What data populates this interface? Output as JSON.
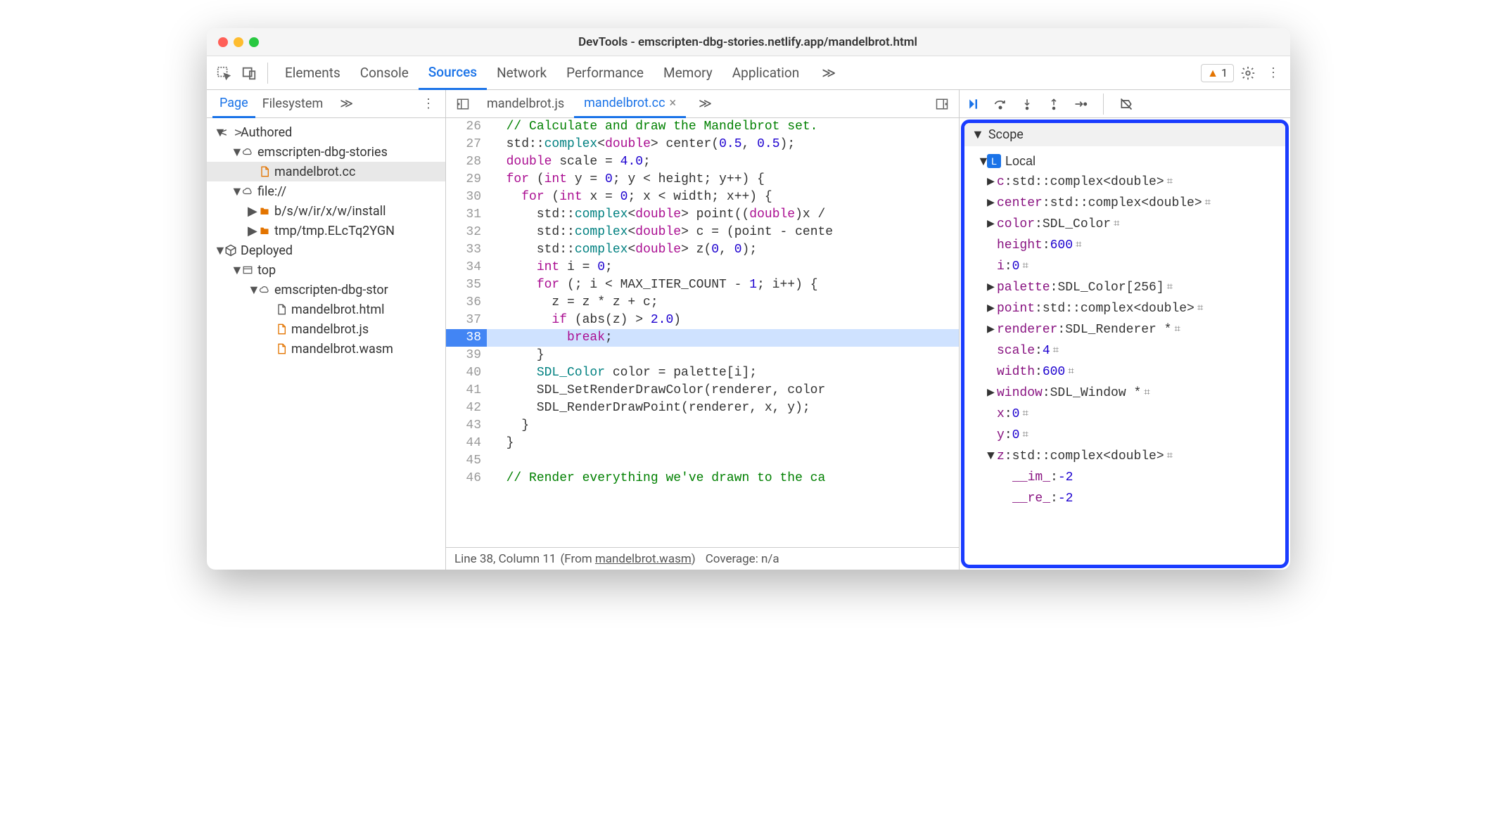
{
  "window": {
    "title": "DevTools - emscripten-dbg-stories.netlify.app/mandelbrot.html"
  },
  "tabs": {
    "items": [
      "Elements",
      "Console",
      "Sources",
      "Network",
      "Performance",
      "Memory",
      "Application"
    ],
    "active": "Sources",
    "warning_count": "1"
  },
  "sidebar": {
    "tabs": [
      "Page",
      "Filesystem"
    ],
    "active": "Page",
    "tree": [
      {
        "indent": 0,
        "twisty": "▼",
        "icon": "brackets",
        "label": "Authored"
      },
      {
        "indent": 1,
        "twisty": "▼",
        "icon": "cloud",
        "label": "emscripten-dbg-stories"
      },
      {
        "indent": 2,
        "twisty": "",
        "icon": "file-orange",
        "label": "mandelbrot.cc",
        "selected": true
      },
      {
        "indent": 1,
        "twisty": "▼",
        "icon": "cloud",
        "label": "file://"
      },
      {
        "indent": 2,
        "twisty": "▶",
        "icon": "folder-orange",
        "label": "b/s/w/ir/x/w/install"
      },
      {
        "indent": 2,
        "twisty": "▶",
        "icon": "folder-orange",
        "label": "tmp/tmp.ELcTq2YGN"
      },
      {
        "indent": 0,
        "twisty": "▼",
        "icon": "box",
        "label": "Deployed"
      },
      {
        "indent": 1,
        "twisty": "▼",
        "icon": "window",
        "label": "top"
      },
      {
        "indent": 2,
        "twisty": "▼",
        "icon": "cloud",
        "label": "emscripten-dbg-stor"
      },
      {
        "indent": 3,
        "twisty": "",
        "icon": "file",
        "label": "mandelbrot.html"
      },
      {
        "indent": 3,
        "twisty": "",
        "icon": "file-orange",
        "label": "mandelbrot.js"
      },
      {
        "indent": 3,
        "twisty": "",
        "icon": "file-orange",
        "label": "mandelbrot.wasm"
      }
    ]
  },
  "editor": {
    "tabs": [
      {
        "label": "mandelbrot.js",
        "active": false,
        "closable": false
      },
      {
        "label": "mandelbrot.cc",
        "active": true,
        "closable": true
      }
    ],
    "status": {
      "line": "Line 38, Column 11",
      "from": "mandelbrot.wasm",
      "coverage": "Coverage: n/a"
    },
    "lines": [
      {
        "n": 26,
        "html": "  <span class='cm'>// Calculate and draw the Mandelbrot set.</span>"
      },
      {
        "n": 27,
        "html": "  std::<span class='type'>complex</span>&lt;<span class='kw'>double</span>&gt; center(<span class='num'>0.5</span>, <span class='num'>0.5</span>);"
      },
      {
        "n": 28,
        "html": "  <span class='kw'>double</span> scale = <span class='num'>4.0</span>;"
      },
      {
        "n": 29,
        "html": "  <span class='kw'>for</span> (<span class='kw'>int</span> y = <span class='num'>0</span>; y &lt; height; y++) {"
      },
      {
        "n": 30,
        "html": "    <span class='kw'>for</span> (<span class='kw'>int</span> x = <span class='num'>0</span>; x &lt; width; x++) {"
      },
      {
        "n": 31,
        "html": "      std::<span class='type'>complex</span>&lt;<span class='kw'>double</span>&gt; point((<span class='kw'>double</span>)x /"
      },
      {
        "n": 32,
        "html": "      std::<span class='type'>complex</span>&lt;<span class='kw'>double</span>&gt; c = (point - cente"
      },
      {
        "n": 33,
        "html": "      std::<span class='type'>complex</span>&lt;<span class='kw'>double</span>&gt; z(<span class='num'>0</span>, <span class='num'>0</span>);"
      },
      {
        "n": 34,
        "html": "      <span class='kw'>int</span> i = <span class='num'>0</span>;"
      },
      {
        "n": 35,
        "html": "      <span class='kw'>for</span> (; i &lt; MAX_ITER_COUNT - <span class='num'>1</span>; i++) {"
      },
      {
        "n": 36,
        "html": "        z = z * z + c;"
      },
      {
        "n": 37,
        "html": "        <span class='kw'>if</span> (abs(z) &gt; <span class='num'>2.0</span>)"
      },
      {
        "n": 38,
        "html": "          <span class='kw'>break</span>;",
        "exec": true
      },
      {
        "n": 39,
        "html": "      }"
      },
      {
        "n": 40,
        "html": "      <span class='type'>SDL_Color</span> color = palette[i];"
      },
      {
        "n": 41,
        "html": "      SDL_SetRenderDrawColor(renderer, color"
      },
      {
        "n": 42,
        "html": "      SDL_RenderDrawPoint(renderer, x, y);"
      },
      {
        "n": 43,
        "html": "    }"
      },
      {
        "n": 44,
        "html": "  }"
      },
      {
        "n": 45,
        "html": ""
      },
      {
        "n": 46,
        "html": "  <span class='cm'>// Render everything we've drawn to the ca</span>"
      }
    ]
  },
  "scope": {
    "title": "Scope",
    "section": "Local",
    "vars": [
      {
        "twisty": "▶",
        "name": "c",
        "type": "std::complex<double>",
        "mem": true
      },
      {
        "twisty": "▶",
        "name": "center",
        "type": "std::complex<double>",
        "mem": true
      },
      {
        "twisty": "▶",
        "name": "color",
        "type": "SDL_Color",
        "mem": true
      },
      {
        "twisty": "",
        "name": "height",
        "value": "600",
        "mem": true
      },
      {
        "twisty": "",
        "name": "i",
        "value": "0",
        "mem": true
      },
      {
        "twisty": "▶",
        "name": "palette",
        "type": "SDL_Color[256]",
        "mem": true
      },
      {
        "twisty": "▶",
        "name": "point",
        "type": "std::complex<double>",
        "mem": true
      },
      {
        "twisty": "▶",
        "name": "renderer",
        "type": "SDL_Renderer *",
        "mem": true
      },
      {
        "twisty": "",
        "name": "scale",
        "value": "4",
        "mem": true
      },
      {
        "twisty": "",
        "name": "width",
        "value": "600",
        "mem": true
      },
      {
        "twisty": "▶",
        "name": "window",
        "type": "SDL_Window *",
        "mem": true
      },
      {
        "twisty": "",
        "name": "x",
        "value": "0",
        "mem": true
      },
      {
        "twisty": "",
        "name": "y",
        "value": "0",
        "mem": true
      },
      {
        "twisty": "▼",
        "name": "z",
        "type": "std::complex<double>",
        "mem": true
      },
      {
        "twisty": "",
        "name": "__im_",
        "value": "-2",
        "indent": 1
      },
      {
        "twisty": "",
        "name": "__re_",
        "value": "-2",
        "indent": 1
      }
    ]
  }
}
